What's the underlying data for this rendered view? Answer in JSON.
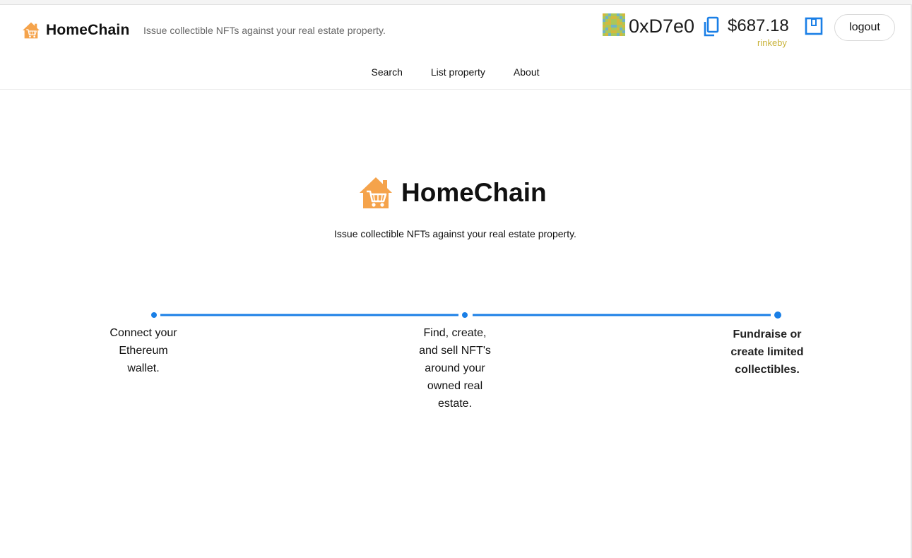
{
  "header": {
    "brand_name": "HomeChain",
    "tagline": "Issue collectible NFTs against your real estate property.",
    "account": {
      "address": "0xD7e0",
      "balance": "$687.18",
      "network": "rinkeby"
    },
    "logout_label": "logout"
  },
  "nav": {
    "items": [
      {
        "label": "Search"
      },
      {
        "label": "List property"
      },
      {
        "label": "About"
      }
    ]
  },
  "hero": {
    "brand_name": "HomeChain",
    "tagline": "Issue collectible NFTs against your real estate property."
  },
  "steps": [
    {
      "text": "Connect your Ethereum wallet."
    },
    {
      "text": "Find, create, and sell NFT's around your owned real estate."
    },
    {
      "text": "Fundraise or create limited collectibles."
    }
  ],
  "colors": {
    "accent_blue": "#1a7fe6",
    "logo_orange": "#f5a34b",
    "network_gold": "#c9b33a"
  },
  "icons": {
    "logo": "house-cart-icon",
    "copy": "copy-icon",
    "wallet": "wallet-icon",
    "avatar": "identicon-avatar"
  }
}
